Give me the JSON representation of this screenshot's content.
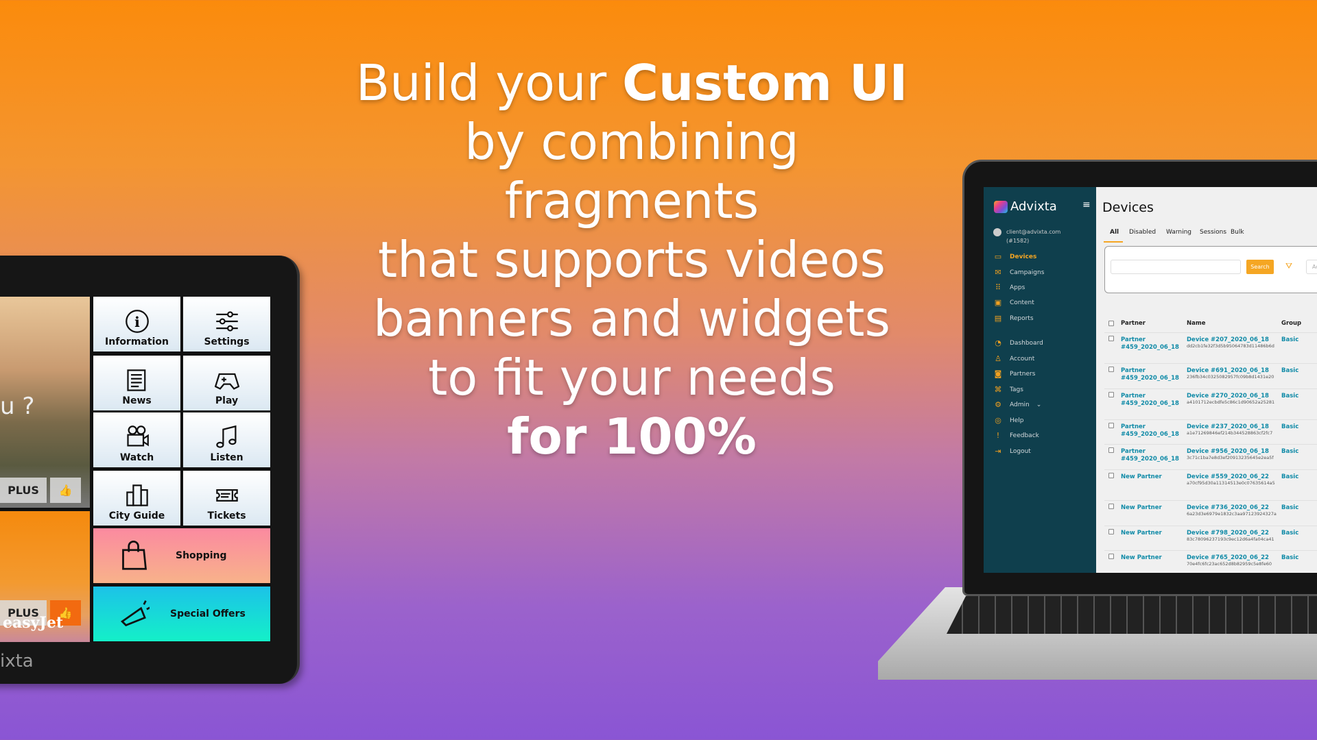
{
  "headline": {
    "l1a": "Build your ",
    "l1b": "Custom UI",
    "l2": "by combining",
    "l3": "fragments",
    "l4": "that supports videos",
    "l5": "banners and widgets",
    "l6": "to fit your needs",
    "l7": "for 100%"
  },
  "tablet": {
    "banner1_text": "u ?",
    "plus": "PLUS",
    "brand_text": "easyJet",
    "logo_fragment": "ixta",
    "tiles": [
      {
        "label": "Information",
        "icon": "info-icon"
      },
      {
        "label": "Settings",
        "icon": "sliders-icon"
      },
      {
        "label": "News",
        "icon": "newspaper-icon"
      },
      {
        "label": "Play",
        "icon": "gamepad-icon"
      },
      {
        "label": "Watch",
        "icon": "video-camera-icon"
      },
      {
        "label": "Listen",
        "icon": "music-note-icon"
      },
      {
        "label": "City Guide",
        "icon": "buildings-icon"
      },
      {
        "label": "Tickets",
        "icon": "ticket-icon"
      },
      {
        "label": "Shopping",
        "icon": "shopping-bag-icon"
      },
      {
        "label": "Special Offers",
        "icon": "megaphone-icon"
      }
    ]
  },
  "app": {
    "brand": "Advixta",
    "user_email": "client@advixta.com",
    "user_id": "(#1582)",
    "accent": "#f5a623",
    "sidebar_bg": "#0f3f4d",
    "link_color": "#0f8aa7",
    "nav": [
      {
        "label": "Devices",
        "icon": "devices-icon",
        "active": true
      },
      {
        "label": "Campaigns",
        "icon": "mail-icon"
      },
      {
        "label": "Apps",
        "icon": "grid-icon"
      },
      {
        "label": "Content",
        "icon": "video-icon"
      },
      {
        "label": "Reports",
        "icon": "report-icon"
      },
      {
        "label": "Dashboard",
        "icon": "gauge-icon"
      },
      {
        "label": "Account",
        "icon": "user-icon"
      },
      {
        "label": "Partners",
        "icon": "briefcase-icon"
      },
      {
        "label": "Tags",
        "icon": "tag-icon"
      },
      {
        "label": "Admin",
        "icon": "gear-icon"
      },
      {
        "label": "Help",
        "icon": "lifebuoy-icon"
      },
      {
        "label": "Feedback",
        "icon": "feedback-icon"
      },
      {
        "label": "Logout",
        "icon": "logout-icon"
      }
    ],
    "title": "Devices",
    "tabs": [
      "All",
      "Disabled",
      "Warning",
      "Sessions",
      "Bulk"
    ],
    "search_button": "Search",
    "search_value": "",
    "extra_input_fragment": "Ac",
    "columns": [
      "Partner",
      "Name",
      "Group"
    ],
    "rows": [
      {
        "partner": "Partner",
        "partner2": "#459_2020_06_18",
        "name": "Device #207_2020_06_18",
        "hash": "dd2cb1fe32f3d5b95064783d11486b6d",
        "group": "Basic"
      },
      {
        "partner": "Partner",
        "partner2": "#459_2020_06_18",
        "name": "Device #691_2020_06_18",
        "hash": "236fb34c0325082957fc09b8d1431e20",
        "group": "Basic"
      },
      {
        "partner": "Partner",
        "partner2": "#459_2020_06_18",
        "name": "Device #270_2020_06_18",
        "hash": "a4101712ecbdfe5c86c1d90652a25281",
        "group": "Basic"
      },
      {
        "partner": "Partner",
        "partner2": "#459_2020_06_18",
        "name": "Device #237_2020_06_18",
        "hash": "a1e71269846ef214b344528863cf2fc7",
        "group": "Basic"
      },
      {
        "partner": "Partner",
        "partner2": "#459_2020_06_18",
        "name": "Device #956_2020_06_18",
        "hash": "3c71c1ba7e8d3ef20913235645e2ea5f",
        "group": "Basic"
      },
      {
        "partner": "New Partner",
        "partner2": "",
        "name": "Device #559_2020_06_22",
        "hash": "a70cf95d30a11314513e0c07635614a5",
        "group": "Basic"
      },
      {
        "partner": "New Partner",
        "partner2": "",
        "name": "Device #736_2020_06_22",
        "hash": "6a23d3e6979e1832c3aa97123924327a",
        "group": "Basic"
      },
      {
        "partner": "New Partner",
        "partner2": "",
        "name": "Device #798_2020_06_22",
        "hash": "83c78096237193c9ec12d6a4fa04ca41",
        "group": "Basic"
      },
      {
        "partner": "New Partner",
        "partner2": "",
        "name": "Device #765_2020_06_22",
        "hash": "70e4fc6fc23ac652d8b82959c5e8fe60",
        "group": "Basic"
      }
    ]
  }
}
